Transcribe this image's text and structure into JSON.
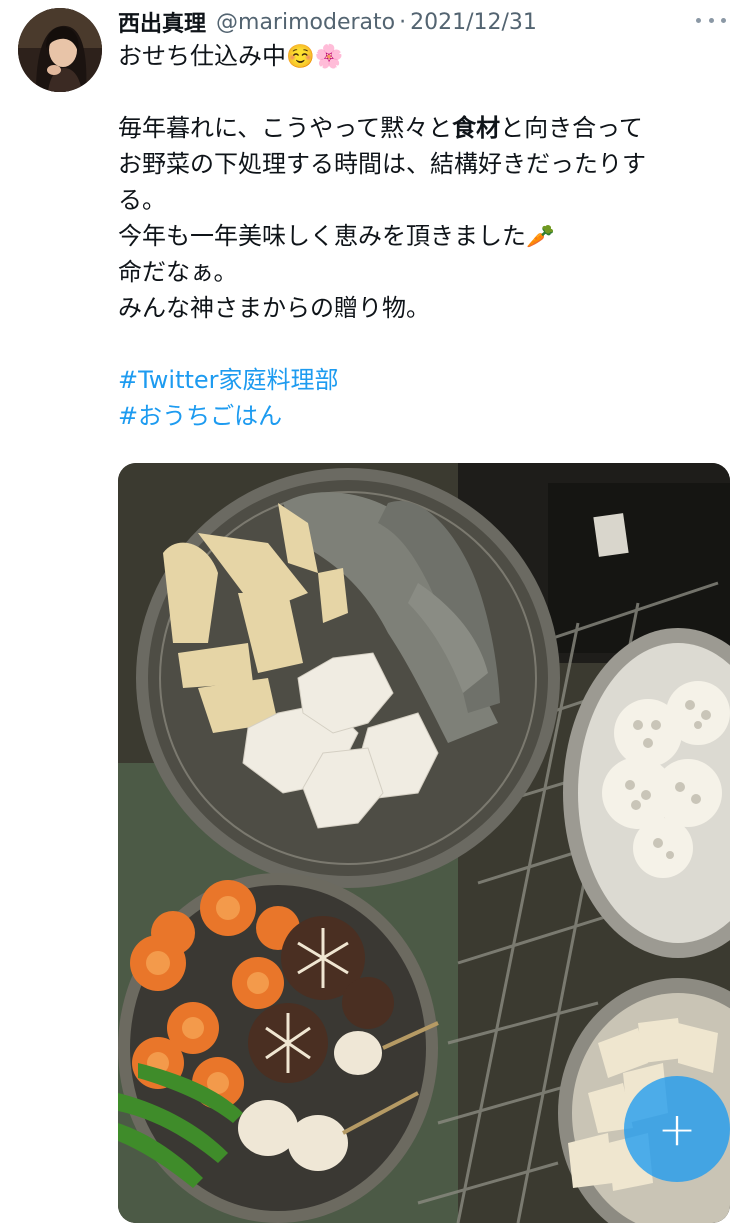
{
  "tweet": {
    "author_name": "西出真理",
    "handle": "@marimoderato",
    "separator": "·",
    "date": "2021/12/31",
    "line1": "おせち仕込み中",
    "line1_emoji1": "☺️",
    "line1_emoji2": "🌸",
    "p2_a": "毎年暮れに、こうやって黙々と",
    "p2_bold": "食材",
    "p2_b": "と向き合って",
    "p2_line2": "お野菜の下処理する時間は、結構好きだったりす",
    "p2_line3": "る。",
    "p2_line4": "今年も一年美味しく恵みを頂きました",
    "p2_line4_emoji": "🥕",
    "p2_line5": "命だなぁ。",
    "p2_line6": "みんな神さまからの贈り物。",
    "hashtag1": "#Twitter家庭料理部",
    "hashtag2": "#おうちごはん"
  },
  "icons": {
    "more": "more-horizontal-icon",
    "compose": "plus-icon"
  },
  "fab": {
    "label": "+"
  },
  "colors": {
    "link": "#1d9bf0",
    "secondary_text": "#536471",
    "fab": "#1d9bf0"
  }
}
